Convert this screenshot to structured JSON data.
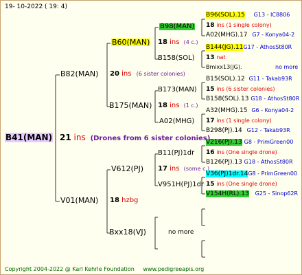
{
  "header": {
    "date": "19- 10-2022 ( 19: 4)"
  },
  "footer": {
    "copyright": "Copyright 2004-2022 @ Karl Kehrle Foundation",
    "site": "www.pedigreeapis.org"
  },
  "colors": {
    "yellow": "#ffff00",
    "green": "#33cc33",
    "cyan": "#00ffff",
    "purple_bg": "#e6ccff"
  },
  "gen1": {
    "queen": "B41(MAN)",
    "ins_num": "21",
    "ins_word": "ins",
    "note": "(Drones from 6 sister colonies)"
  },
  "gen2": [
    {
      "name": "B82(MAN)",
      "ins_num": "20",
      "ins_word": "ins",
      "note": "(6 sister colonies)"
    },
    {
      "name": "V01(MAN)",
      "ins_num": "18",
      "ins_word": "hzbg"
    }
  ],
  "gen3": [
    {
      "name": "B60(MAN)",
      "ins_num": "18",
      "ins_word": "ins",
      "note": "(4 c.)"
    },
    {
      "name": "B175(MAN)",
      "ins_num": "18",
      "ins_word": "ins",
      "note": "(1 c.)"
    },
    {
      "name": "V612(PJ)",
      "ins_num": "17",
      "ins_word": "ins",
      "note": "(some c.)"
    },
    {
      "name": "Bxx18(VJ)",
      "note": "no more"
    }
  ],
  "gen4": [
    {
      "name": "B98(MAN)"
    },
    {
      "name": "B158(SOL)"
    },
    {
      "name": "B173(MAN)"
    },
    {
      "name": "A02(MHG)"
    },
    {
      "name": "B11(PJ)1dr"
    },
    {
      "name": "V951H(PJ)1dr"
    }
  ],
  "gen5": [
    {
      "line1": "B96(SOL).15",
      "code": "G13 - IC8806",
      "num": "18",
      "info": "ins (1 single colony)"
    },
    {
      "line1": "A02(MHG).17",
      "code": "G7 - Konya04-2"
    },
    {
      "line1": "B144(JG).11",
      "code": "G17 - AthosSt80R",
      "num": "13",
      "info": "nat"
    },
    {
      "line1": "Bmixx13(JG).",
      "code": "no more"
    },
    {
      "line1": "B15(SOL).12",
      "code": "G11 - Takab93R",
      "num": "15",
      "info": "ins (6 sister colonies)"
    },
    {
      "line1": "B158(SOL).13",
      "code": "G18 - AthosSt80R"
    },
    {
      "line1": "A32(MHG).15",
      "code": "G6 - Konya04-2",
      "num": "17",
      "info": "ins (1 single colony)"
    },
    {
      "line1": "B298(PJ).14",
      "code": "G12 - Takab93R"
    },
    {
      "line1": "V216(PJ).13",
      "code": "G8 - PrimGreen00",
      "num": "16",
      "info": "ins (One single drone)"
    },
    {
      "line1": "B126(PJ).13",
      "code": "G18 - AthosSt80R"
    },
    {
      "line1": "V36(PJ)1dr.14",
      "code": "G8 - PrimGreen00",
      "num": "15",
      "info": "ins (One single drone)"
    },
    {
      "line1": "V154H(RL).13",
      "code": "G25 - Sinop62R"
    }
  ]
}
